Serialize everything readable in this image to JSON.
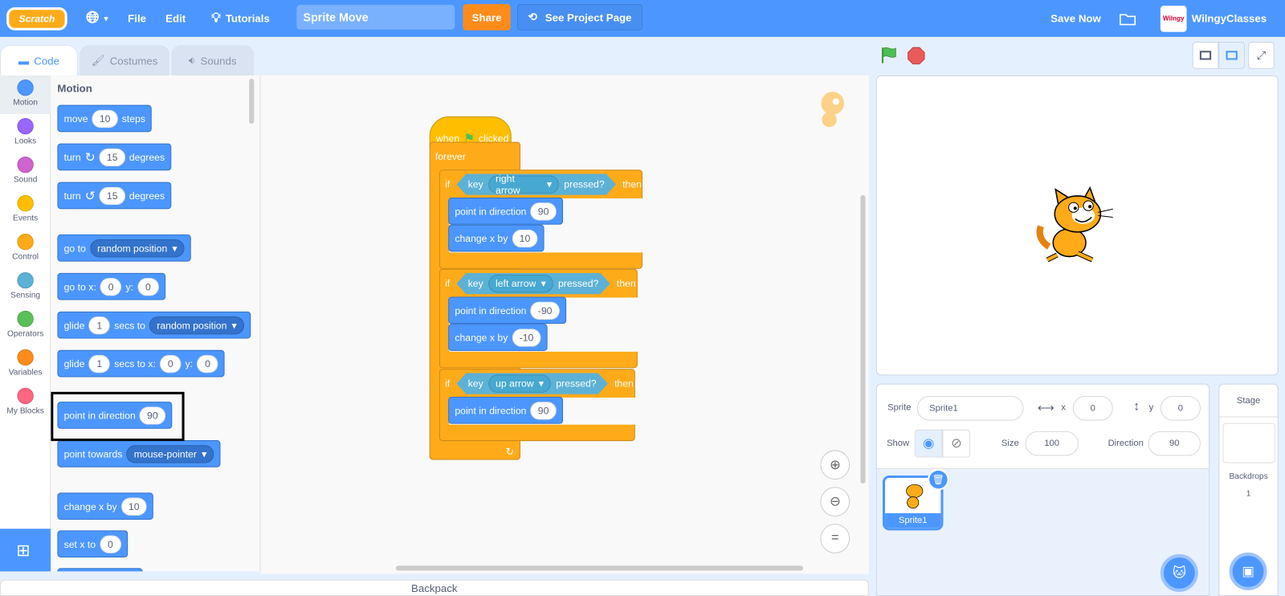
{
  "menubar": {
    "logo": "Scratch",
    "file": "File",
    "edit": "Edit",
    "tutorials": "Tutorials",
    "project_title": "Sprite Move",
    "share": "Share",
    "see_project_page": "See Project Page",
    "save_now": "Save Now",
    "username": "WilngyClasses",
    "avatar_text": "Wilngy"
  },
  "tabs": [
    {
      "label": "Code",
      "icon": "code-icon"
    },
    {
      "label": "Costumes",
      "icon": "brush-icon"
    },
    {
      "label": "Sounds",
      "icon": "speaker-icon"
    }
  ],
  "categories": [
    {
      "label": "Motion",
      "color": "#4c97ff"
    },
    {
      "label": "Looks",
      "color": "#9966ff"
    },
    {
      "label": "Sound",
      "color": "#cf63cf"
    },
    {
      "label": "Events",
      "color": "#ffbf00"
    },
    {
      "label": "Control",
      "color": "#ffab19"
    },
    {
      "label": "Sensing",
      "color": "#5cb1d6"
    },
    {
      "label": "Operators",
      "color": "#59c059"
    },
    {
      "label": "Variables",
      "color": "#ff8c1a"
    },
    {
      "label": "My Blocks",
      "color": "#ff6680"
    }
  ],
  "palette": {
    "title": "Motion",
    "blocks": [
      {
        "parts": [
          {
            "t": "move"
          },
          {
            "n": "10"
          },
          {
            "t": "steps"
          }
        ]
      },
      {
        "parts": [
          {
            "t": "turn"
          },
          {
            "i": "↻"
          },
          {
            "n": "15"
          },
          {
            "t": "degrees"
          }
        ]
      },
      {
        "parts": [
          {
            "t": "turn"
          },
          {
            "i": "↺"
          },
          {
            "n": "15"
          },
          {
            "t": "degrees"
          }
        ]
      },
      {
        "parts": [
          {
            "t": "go to"
          },
          {
            "d": "random position"
          }
        ]
      },
      {
        "parts": [
          {
            "t": "go to x:"
          },
          {
            "n": "0"
          },
          {
            "t": "y:"
          },
          {
            "n": "0"
          }
        ]
      },
      {
        "parts": [
          {
            "t": "glide"
          },
          {
            "n": "1"
          },
          {
            "t": "secs to"
          },
          {
            "d": "random position"
          }
        ]
      },
      {
        "parts": [
          {
            "t": "glide"
          },
          {
            "n": "1"
          },
          {
            "t": "secs to x:"
          },
          {
            "n": "0"
          },
          {
            "t": "y:"
          },
          {
            "n": "0"
          }
        ]
      },
      {
        "parts": [
          {
            "t": "point in direction"
          },
          {
            "n": "90"
          }
        ]
      },
      {
        "parts": [
          {
            "t": "point towards"
          },
          {
            "d": "mouse-pointer"
          }
        ]
      },
      {
        "parts": [
          {
            "t": "change x by"
          },
          {
            "n": "10"
          }
        ]
      },
      {
        "parts": [
          {
            "t": "set x to"
          },
          {
            "n": "0"
          }
        ]
      }
    ],
    "highlighted_block": 7
  },
  "script": {
    "hat": {
      "when": "when",
      "clicked": "clicked"
    },
    "forever": "forever",
    "ifs": [
      {
        "if": "if",
        "key": "key",
        "value": "right arrow",
        "pressed": "pressed?",
        "then": "then",
        "body": [
          {
            "parts": [
              {
                "t": "point in direction"
              },
              {
                "n": "90"
              }
            ]
          },
          {
            "parts": [
              {
                "t": "change x by"
              },
              {
                "n": "10"
              }
            ]
          }
        ]
      },
      {
        "if": "if",
        "key": "key",
        "value": "left arrow",
        "pressed": "pressed?",
        "then": "then",
        "body": [
          {
            "parts": [
              {
                "t": "point in direction"
              },
              {
                "n": "-90"
              }
            ]
          },
          {
            "parts": [
              {
                "t": "change x by"
              },
              {
                "n": "-10"
              }
            ]
          }
        ]
      },
      {
        "if": "if",
        "key": "key",
        "value": "up arrow",
        "pressed": "pressed?",
        "then": "then",
        "body": [
          {
            "parts": [
              {
                "t": "point in direction"
              },
              {
                "n": "90"
              }
            ]
          }
        ]
      }
    ]
  },
  "backpack": "Backpack",
  "sprite_info": {
    "sprite_label": "Sprite",
    "sprite_name": "Sprite1",
    "x_label": "x",
    "x": "0",
    "y_label": "y",
    "y": "0",
    "show_label": "Show",
    "size_label": "Size",
    "size": "100",
    "direction_label": "Direction",
    "direction": "90"
  },
  "sprites": [
    {
      "name": "Sprite1",
      "selected": true
    }
  ],
  "stage_pane": {
    "title": "Stage",
    "backdrops_label": "Backdrops",
    "backdrops_count": "1"
  }
}
